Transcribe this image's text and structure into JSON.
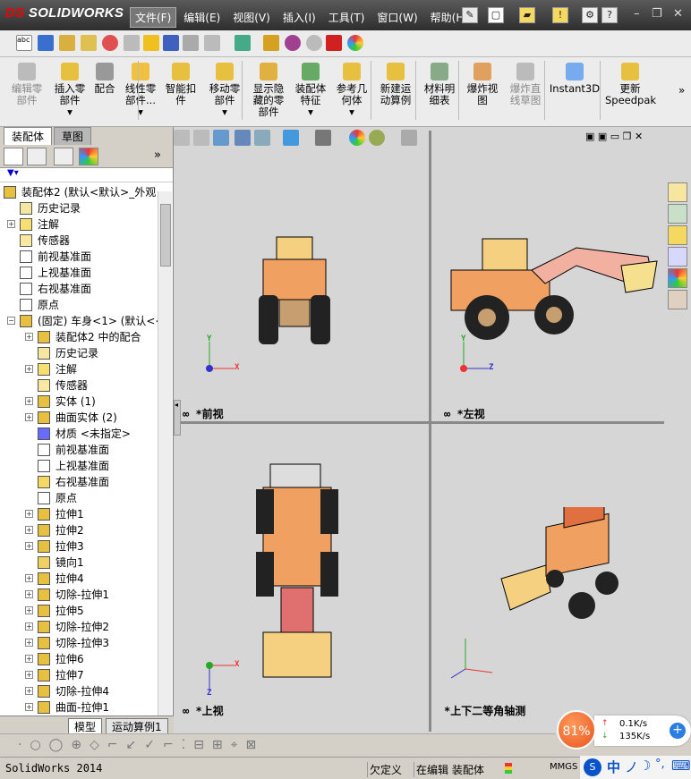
{
  "app": {
    "brand": "SOLIDWORKS",
    "brand_prefix": "DS"
  },
  "menus": [
    "文件(F)",
    "编辑(E)",
    "视图(V)",
    "插入(I)",
    "工具(T)",
    "窗口(W)",
    "帮助(H)"
  ],
  "command_buttons": [
    {
      "label": "编辑零\n部件",
      "disabled": true
    },
    {
      "label": "插入零\n部件\n▾",
      "disabled": false
    },
    {
      "label": "配合",
      "disabled": false
    },
    {
      "label": "线性零\n部件...\n▾",
      "disabled": false
    },
    {
      "label": "智能扣\n件",
      "disabled": false
    },
    {
      "label": "移动零\n部件\n▾",
      "disabled": false
    },
    {
      "label": "显示隐\n藏的零\n部件",
      "disabled": false
    },
    {
      "label": "装配体\n特征\n▾",
      "disabled": false
    },
    {
      "label": "参考几\n何体\n▾",
      "disabled": false
    },
    {
      "label": "新建运\n动算例",
      "disabled": false
    },
    {
      "label": "材料明\n细表",
      "disabled": false
    },
    {
      "label": "爆炸视\n图",
      "disabled": false
    },
    {
      "label": "爆炸直\n线草图",
      "disabled": true
    },
    {
      "label": "Instant3D",
      "disabled": false
    },
    {
      "label": "更新\nSpeedpak",
      "disabled": false
    }
  ],
  "left_tabs": [
    "装配体",
    "草图"
  ],
  "tree": [
    {
      "level": 0,
      "exp": "-",
      "label": "装配体2  (默认<默认>_外观",
      "icon": "assembly-icon"
    },
    {
      "level": 1,
      "exp": "",
      "label": "历史记录",
      "icon": "history-icon"
    },
    {
      "level": 1,
      "exp": "+",
      "label": "注解",
      "icon": "annotation-icon"
    },
    {
      "level": 1,
      "exp": "",
      "label": "传感器",
      "icon": "sensor-icon"
    },
    {
      "level": 1,
      "exp": "",
      "label": "前视基准面",
      "icon": "plane-icon"
    },
    {
      "level": 1,
      "exp": "",
      "label": "上视基准面",
      "icon": "plane-icon"
    },
    {
      "level": 1,
      "exp": "",
      "label": "右视基准面",
      "icon": "plane-icon"
    },
    {
      "level": 1,
      "exp": "",
      "label": "原点",
      "icon": "origin-icon"
    },
    {
      "level": 1,
      "exp": "-",
      "label": "(固定) 车身<1> (默认<<",
      "icon": "part-icon"
    },
    {
      "level": 2,
      "exp": "+",
      "label": "装配体2 中的配合",
      "icon": "mate-icon"
    },
    {
      "level": 2,
      "exp": "",
      "label": "历史记录",
      "icon": "history-icon"
    },
    {
      "level": 2,
      "exp": "+",
      "label": "注解",
      "icon": "annotation-icon"
    },
    {
      "level": 2,
      "exp": "",
      "label": "传感器",
      "icon": "sensor-icon"
    },
    {
      "level": 2,
      "exp": "+",
      "label": "实体 (1)",
      "icon": "solid-body-icon"
    },
    {
      "level": 2,
      "exp": "+",
      "label": "曲面实体 (2)",
      "icon": "surface-body-icon"
    },
    {
      "level": 2,
      "exp": "",
      "label": "材质 <未指定>",
      "icon": "material-icon"
    },
    {
      "level": 2,
      "exp": "",
      "label": "前视基准面",
      "icon": "plane-icon"
    },
    {
      "level": 2,
      "exp": "",
      "label": "上视基准面",
      "icon": "plane-icon"
    },
    {
      "level": 2,
      "exp": "",
      "label": "右视基准面",
      "icon": "plane-selected-icon"
    },
    {
      "level": 2,
      "exp": "",
      "label": "原点",
      "icon": "origin-icon"
    },
    {
      "level": 2,
      "exp": "+",
      "label": "拉伸1",
      "icon": "extrude-icon"
    },
    {
      "level": 2,
      "exp": "+",
      "label": "拉伸2",
      "icon": "extrude-icon"
    },
    {
      "level": 2,
      "exp": "+",
      "label": "拉伸3",
      "icon": "extrude-icon"
    },
    {
      "level": 2,
      "exp": "",
      "label": "镜向1",
      "icon": "mirror-icon"
    },
    {
      "level": 2,
      "exp": "+",
      "label": "拉伸4",
      "icon": "extrude-icon"
    },
    {
      "level": 2,
      "exp": "+",
      "label": "切除-拉伸1",
      "icon": "cut-extrude-icon"
    },
    {
      "level": 2,
      "exp": "+",
      "label": "拉伸5",
      "icon": "extrude-icon"
    },
    {
      "level": 2,
      "exp": "+",
      "label": "切除-拉伸2",
      "icon": "cut-extrude-icon"
    },
    {
      "level": 2,
      "exp": "+",
      "label": "切除-拉伸3",
      "icon": "cut-extrude-icon"
    },
    {
      "level": 2,
      "exp": "+",
      "label": "拉伸6",
      "icon": "extrude-icon"
    },
    {
      "level": 2,
      "exp": "+",
      "label": "拉伸7",
      "icon": "extrude-icon"
    },
    {
      "level": 2,
      "exp": "+",
      "label": "切除-拉伸4",
      "icon": "cut-extrude-icon"
    },
    {
      "level": 2,
      "exp": "+",
      "label": "曲面-拉伸1",
      "icon": "surface-extrude-icon"
    }
  ],
  "bottom_tabs": [
    "模型",
    "运动算例1"
  ],
  "views": {
    "front": "*前视",
    "left": "*左视",
    "top": "*上视",
    "iso": "*上下二等角轴测"
  },
  "axis": {
    "x": "X",
    "y": "Y",
    "z": "Z"
  },
  "status": {
    "app": "SolidWorks 2014",
    "underdefined": "欠定义",
    "editing": "在编辑 装配体",
    "units": "MMGS"
  },
  "net": {
    "percent": "81%",
    "up": "0.1K/s",
    "down": "135K/s",
    "up_arrow": "↑",
    "down_arrow": "↓",
    "plus": "+"
  },
  "ime": {
    "t1": "中",
    "t2": "ノ",
    "t3": "☽",
    "t4": "°,",
    "t5": "⌨"
  },
  "colors": {
    "loader_orange": "#f0a060",
    "loader_yellow": "#f5d080",
    "dark": "#222222",
    "accent": "#2a7de1"
  }
}
